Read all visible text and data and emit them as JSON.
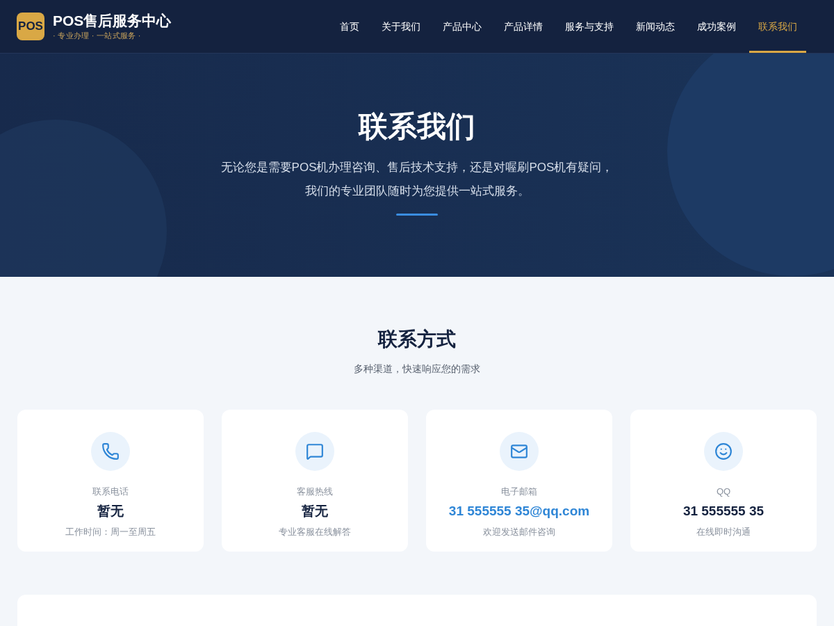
{
  "logo": {
    "mark": "POS",
    "name": "POS售后服务中心",
    "tagline": "· 专业办理 · 一站式服务 ·"
  },
  "nav": [
    {
      "label": "首页",
      "selected": false
    },
    {
      "label": "关于我们",
      "selected": false
    },
    {
      "label": "产品中心",
      "selected": false
    },
    {
      "label": "产品详情",
      "selected": false
    },
    {
      "label": "服务与支持",
      "selected": false
    },
    {
      "label": "新闻动态",
      "selected": false
    },
    {
      "label": "成功案例",
      "selected": false
    },
    {
      "label": "联系我们",
      "selected": true
    }
  ],
  "hero": {
    "title": "联系我们",
    "lines": [
      "无论您是需要POS机办理咨询、售后技术支持，还是对喔刷POS机有疑问，",
      "我们的专业团队随时为您提供一站式服务。"
    ]
  },
  "section": {
    "title": "联系方式",
    "subtitle": "多种渠道，快速响应您的需求"
  },
  "cards": [
    {
      "label": "联系电话",
      "value": "暂无",
      "kind": "text",
      "note": "工作时间：周一至周五"
    },
    {
      "label": "客服热线",
      "value": "暂无",
      "kind": "text",
      "note": "专业客服在线解答"
    },
    {
      "label": "电子邮箱",
      "value": "31 555555 35@qq.com",
      "kind": "link",
      "note": "欢迎发送邮件咨询"
    },
    {
      "label": "QQ",
      "value": "31 555555 35",
      "kind": "text",
      "note": "在线即时沟通"
    }
  ]
}
